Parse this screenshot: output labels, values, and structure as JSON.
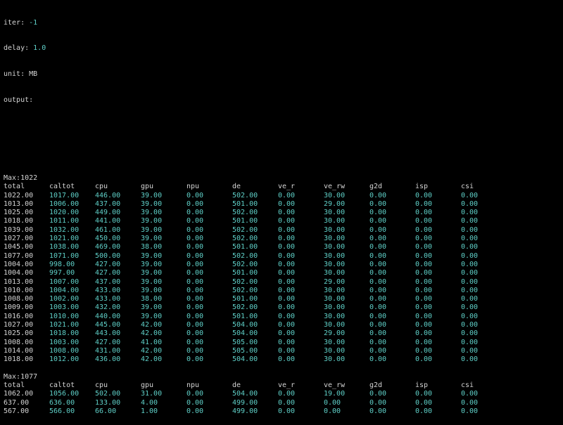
{
  "terminal": {
    "config": [
      {
        "key": "iter:",
        "value": "-1"
      },
      {
        "key": "delay:",
        "value": "1.0"
      },
      {
        "key": "unit:",
        "value": "MB"
      },
      {
        "key": "output:",
        "value": ""
      }
    ],
    "columns": [
      "total",
      "caltot",
      "cpu",
      "gpu",
      "npu",
      "de",
      "ve_r",
      "ve_rw",
      "g2d",
      "isp",
      "csi"
    ],
    "blocks": [
      {
        "max_label": "Max:1022",
        "rows": [
          [
            "1022.00",
            "1017.00",
            "446.00",
            "39.00",
            "0.00",
            "502.00",
            "0.00",
            "30.00",
            "0.00",
            "0.00",
            "0.00"
          ],
          [
            "1013.00",
            "1006.00",
            "437.00",
            "39.00",
            "0.00",
            "501.00",
            "0.00",
            "29.00",
            "0.00",
            "0.00",
            "0.00"
          ],
          [
            "1025.00",
            "1020.00",
            "449.00",
            "39.00",
            "0.00",
            "502.00",
            "0.00",
            "30.00",
            "0.00",
            "0.00",
            "0.00"
          ],
          [
            "1018.00",
            "1011.00",
            "441.00",
            "39.00",
            "0.00",
            "501.00",
            "0.00",
            "30.00",
            "0.00",
            "0.00",
            "0.00"
          ],
          [
            "1039.00",
            "1032.00",
            "461.00",
            "39.00",
            "0.00",
            "502.00",
            "0.00",
            "30.00",
            "0.00",
            "0.00",
            "0.00"
          ],
          [
            "1027.00",
            "1021.00",
            "450.00",
            "39.00",
            "0.00",
            "502.00",
            "0.00",
            "30.00",
            "0.00",
            "0.00",
            "0.00"
          ],
          [
            "1045.00",
            "1038.00",
            "469.00",
            "38.00",
            "0.00",
            "501.00",
            "0.00",
            "30.00",
            "0.00",
            "0.00",
            "0.00"
          ],
          [
            "1077.00",
            "1071.00",
            "500.00",
            "39.00",
            "0.00",
            "502.00",
            "0.00",
            "30.00",
            "0.00",
            "0.00",
            "0.00"
          ],
          [
            "1004.00",
            "998.00",
            "427.00",
            "39.00",
            "0.00",
            "502.00",
            "0.00",
            "30.00",
            "0.00",
            "0.00",
            "0.00"
          ],
          [
            "1004.00",
            "997.00",
            "427.00",
            "39.00",
            "0.00",
            "501.00",
            "0.00",
            "30.00",
            "0.00",
            "0.00",
            "0.00"
          ],
          [
            "1013.00",
            "1007.00",
            "437.00",
            "39.00",
            "0.00",
            "502.00",
            "0.00",
            "29.00",
            "0.00",
            "0.00",
            "0.00"
          ],
          [
            "1010.00",
            "1004.00",
            "433.00",
            "39.00",
            "0.00",
            "502.00",
            "0.00",
            "30.00",
            "0.00",
            "0.00",
            "0.00"
          ],
          [
            "1008.00",
            "1002.00",
            "433.00",
            "38.00",
            "0.00",
            "501.00",
            "0.00",
            "30.00",
            "0.00",
            "0.00",
            "0.00"
          ],
          [
            "1009.00",
            "1003.00",
            "432.00",
            "39.00",
            "0.00",
            "502.00",
            "0.00",
            "30.00",
            "0.00",
            "0.00",
            "0.00"
          ],
          [
            "1016.00",
            "1010.00",
            "440.00",
            "39.00",
            "0.00",
            "501.00",
            "0.00",
            "30.00",
            "0.00",
            "0.00",
            "0.00"
          ],
          [
            "1027.00",
            "1021.00",
            "445.00",
            "42.00",
            "0.00",
            "504.00",
            "0.00",
            "30.00",
            "0.00",
            "0.00",
            "0.00"
          ],
          [
            "1025.00",
            "1018.00",
            "443.00",
            "42.00",
            "0.00",
            "504.00",
            "0.00",
            "29.00",
            "0.00",
            "0.00",
            "0.00"
          ],
          [
            "1008.00",
            "1003.00",
            "427.00",
            "41.00",
            "0.00",
            "505.00",
            "0.00",
            "30.00",
            "0.00",
            "0.00",
            "0.00"
          ],
          [
            "1014.00",
            "1008.00",
            "431.00",
            "42.00",
            "0.00",
            "505.00",
            "0.00",
            "30.00",
            "0.00",
            "0.00",
            "0.00"
          ],
          [
            "1018.00",
            "1012.00",
            "436.00",
            "42.00",
            "0.00",
            "504.00",
            "0.00",
            "30.00",
            "0.00",
            "0.00",
            "0.00"
          ]
        ]
      },
      {
        "max_label": "Max:1077",
        "rows": [
          [
            "1062.00",
            "1056.00",
            "502.00",
            "31.00",
            "0.00",
            "504.00",
            "0.00",
            "19.00",
            "0.00",
            "0.00",
            "0.00"
          ],
          [
            "637.00",
            "636.00",
            "133.00",
            "4.00",
            "0.00",
            "499.00",
            "0.00",
            "0.00",
            "0.00",
            "0.00",
            "0.00"
          ],
          [
            "567.00",
            "566.00",
            "66.00",
            "1.00",
            "0.00",
            "499.00",
            "0.00",
            "0.00",
            "0.00",
            "0.00",
            "0.00"
          ]
        ]
      }
    ]
  },
  "colors": {
    "background": "#000000",
    "text": "#d4d4d4",
    "value_accent": "#5fd0c8"
  }
}
